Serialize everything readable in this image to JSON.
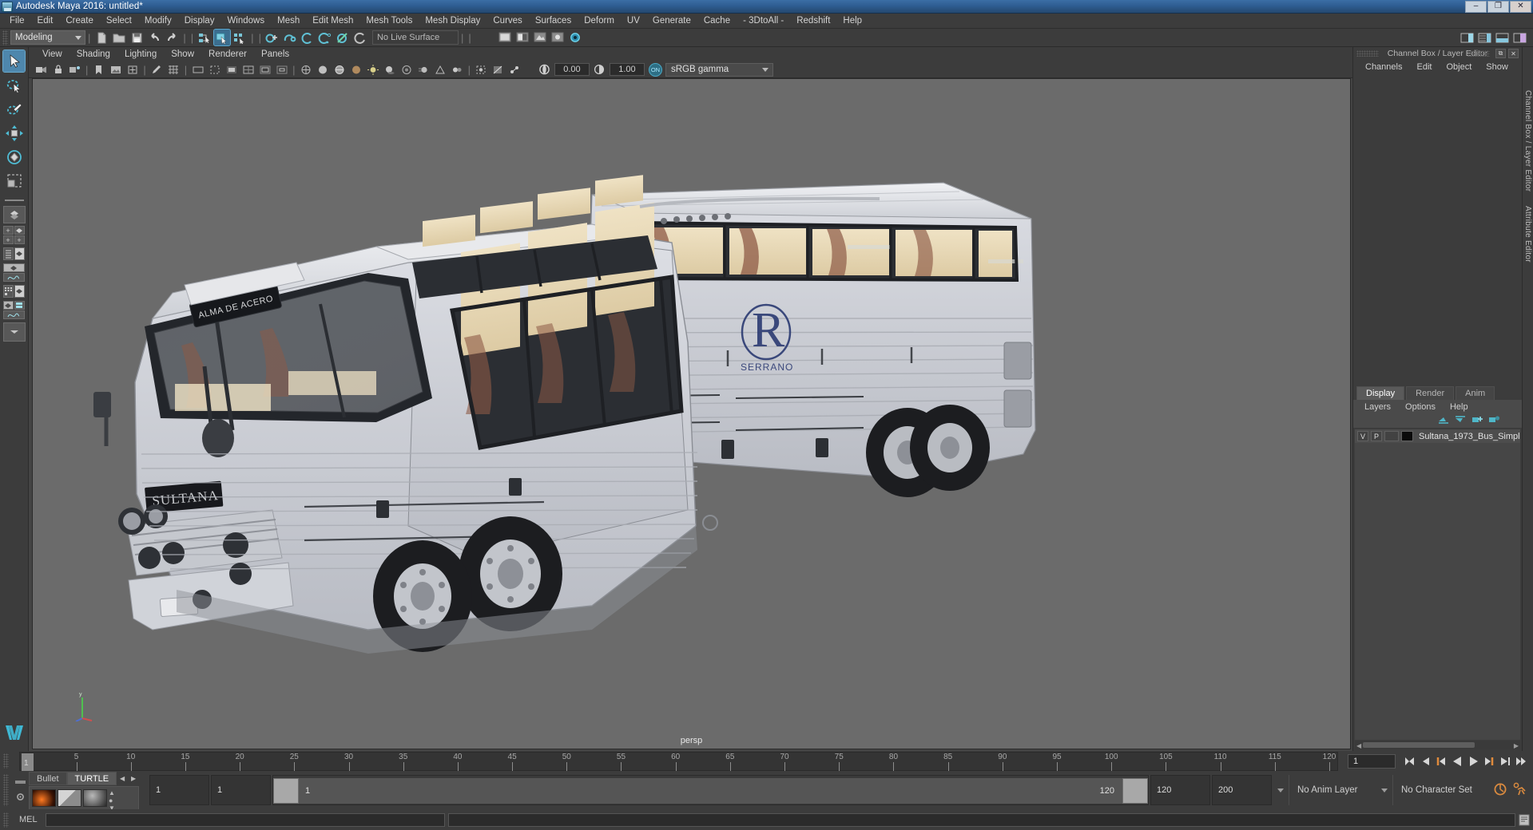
{
  "window": {
    "title": "Autodesk Maya 2016: untitled*",
    "buttons": [
      "minimize",
      "maximize",
      "close"
    ],
    "glyphs": {
      "minimize": "–",
      "maximize": "❐",
      "close": "✕"
    }
  },
  "menubar": {
    "items": [
      "File",
      "Edit",
      "Create",
      "Select",
      "Modify",
      "Display",
      "Windows",
      "Mesh",
      "Edit Mesh",
      "Mesh Tools",
      "Mesh Display",
      "Curves",
      "Surfaces",
      "Deform",
      "UV",
      "Generate",
      "Cache",
      "- 3DtoAll -",
      "Redshift",
      "Help"
    ]
  },
  "statusbar": {
    "mode": "Modeling",
    "live_surface": "No Live Surface",
    "icons": [
      "new-scene-icon",
      "open-scene-icon",
      "save-scene-icon",
      "undo-icon",
      "redo-icon",
      "select-hierarchy-icon",
      "select-object-icon",
      "select-component-icon",
      "snap-to-grid-icon",
      "snap-to-curve-icon",
      "snap-to-point-icon",
      "snap-to-projected-center-icon",
      "snap-to-view-plane-icon",
      "make-live-icon",
      "show-render-view-icon",
      "render-current-frame-icon",
      "ipr-render-icon",
      "render-settings-icon",
      "toggle-light-icon"
    ],
    "right_icons": [
      "show-hide-editors-icon",
      "channel-box-toggle-icon",
      "layer-editor-toggle-icon",
      "attribute-editor-toggle-icon"
    ]
  },
  "viewport_panel": {
    "menus": [
      "View",
      "Shading",
      "Lighting",
      "Show",
      "Renderer",
      "Panels"
    ],
    "toolbar": {
      "exposure_value": "0.00",
      "gamma_value": "1.00",
      "color_management": "sRGB gamma",
      "on_badge": "ON",
      "icons": [
        "select-camera-icon",
        "lock-camera-icon",
        "camera-attributes-icon",
        "bookmark-icon",
        "image-plane-icon",
        "two-dimensional-pan-zoom-icon",
        "grease-pencil-icon",
        "grid-icon",
        "film-gate-icon",
        "resolution-gate-icon",
        "gate-mask-icon",
        "field-chart-icon",
        "safe-action-icon",
        "safe-title-icon",
        "wireframe-icon",
        "smooth-shade-icon",
        "shaded-wireframe-icon",
        "textured-icon",
        "use-all-lights-icon",
        "shadows-icon",
        "screen-space-ao-icon",
        "motion-blur-icon",
        "multisample-aa-icon",
        "depth-of-field-icon",
        "isolate-select-icon",
        "xray-icon",
        "xray-joints-icon",
        "exposure-icon",
        "contrast-icon"
      ]
    },
    "camera_label": "persp",
    "axis": {
      "x": "x",
      "y": "y",
      "z": "z"
    }
  },
  "toolbox": {
    "tools": [
      "select-tool",
      "lasso-select-tool",
      "paint-select-tool",
      "move-tool",
      "rotate-tool",
      "scale-tool"
    ],
    "layouts": [
      "single-perspective-layout",
      "four-view-layout",
      "persp-outliner-layout",
      "persp-graph-editor-layout",
      "hypershade-persp-layout",
      "persp-outliner-graph-layout",
      "layout-more-dropdown"
    ]
  },
  "channel_box": {
    "dock_title": "Channel Box / Layer Editor",
    "menus": [
      "Channels",
      "Edit",
      "Object",
      "Show"
    ],
    "dock_buttons": [
      "undock-icon",
      "close-icon"
    ]
  },
  "layer_editor": {
    "tabs": [
      "Display",
      "Render",
      "Anim"
    ],
    "active_tab": "Display",
    "menus": [
      "Layers",
      "Options",
      "Help"
    ],
    "buttons": [
      "move-layer-up-icon",
      "move-layer-down-icon",
      "new-layer-icon",
      "new-layer-from-selected-icon"
    ],
    "layers": [
      {
        "visibility": "V",
        "playback": "P",
        "shading": "",
        "color": "#0b0b0b",
        "name": "Sultana_1973_Bus_Simpl"
      }
    ]
  },
  "vertical_tabs": [
    "Channel Box / Layer Editor",
    "Attribute Editor"
  ],
  "time_slider": {
    "current_frame": "1",
    "start": 1,
    "end": 120,
    "ticks": [
      5,
      10,
      15,
      20,
      25,
      30,
      35,
      40,
      45,
      50,
      55,
      60,
      65,
      70,
      75,
      80,
      85,
      90,
      95,
      100,
      105,
      110,
      115,
      120
    ],
    "frame_field": "1",
    "playback_buttons": [
      "go-to-start-icon",
      "step-back-keyframe-icon",
      "step-back-frame-icon",
      "play-backwards-icon",
      "play-forwards-icon",
      "step-forward-frame-icon",
      "step-forward-keyframe-icon",
      "go-to-end-icon"
    ]
  },
  "range_slider": {
    "anim_start": "1",
    "range_start": "1",
    "range_start_label": "1",
    "range_end_label": "120",
    "range_end": "120",
    "anim_end": "200",
    "anim_layer": "No Anim Layer",
    "character_set": "No Character Set",
    "right_icons": [
      "auto-keyframe-icon",
      "animation-preferences-icon"
    ]
  },
  "shelf_mini": {
    "tabs": [
      "Bullet",
      "TURTLE"
    ],
    "active_tab": "TURTLE",
    "arrows": [
      "prev-shelf-icon",
      "next-shelf-icon"
    ],
    "swatches": [
      "turtle-render-icon",
      "turtle-bake-icon",
      "turtle-material-icon"
    ]
  },
  "command_line": {
    "label": "MEL",
    "input_value": "",
    "output_value": "",
    "script_editor_icon": "script-editor-icon"
  },
  "scene": {
    "object_name": "Sultana_1973_Bus_Simpl",
    "logo_text": "ALMA DE ACERO",
    "brand_text": "SULTANA",
    "emblem_sub": "SERRANO",
    "emblem_letter": "R"
  },
  "colors": {
    "title_bar": "#2f5d92",
    "panel_bg": "#3c3c3c",
    "viewport_bg": "#6b6b6b",
    "accent_blue": "#4e87ad",
    "accent_teal": "#46a8c0",
    "accent_orange": "#e08a3c"
  }
}
